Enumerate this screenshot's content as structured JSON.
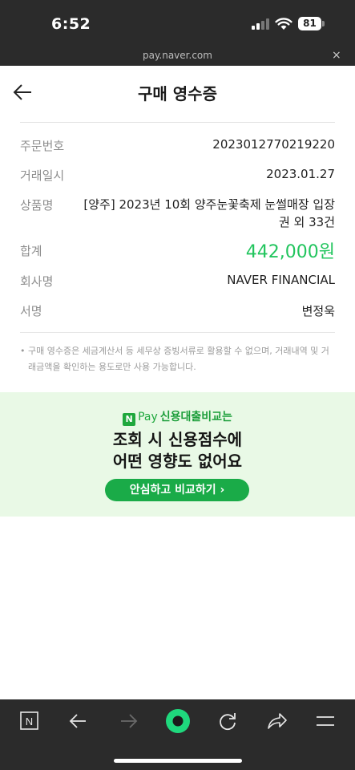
{
  "status_bar": {
    "time": "6:52",
    "battery": "81"
  },
  "url_bar": {
    "url": "pay.naver.com",
    "close": "×"
  },
  "header": {
    "title": "구매 영수증"
  },
  "receipt": {
    "rows": [
      {
        "label": "주문번호",
        "value": "2023012770219220"
      },
      {
        "label": "거래일시",
        "value": "2023.01.27"
      },
      {
        "label": "상품명",
        "value": "[양주] 2023년 10회 양주눈꽃축제 눈썰매장 입장권 외 33건"
      },
      {
        "label": "합계",
        "value": "442,000원"
      },
      {
        "label": "회사명",
        "value": "NAVER FINANCIAL"
      },
      {
        "label": "서명",
        "value": "변정욱"
      }
    ],
    "notice": "구매 영수증은 세금계산서 등 세무상 증빙서류로 활용할 수 없으며, 거래내역 및 거래금액을 확인하는 용도로만 사용 가능합니다.",
    "notice_bullet": "•"
  },
  "banner": {
    "brand_n": "N",
    "brand_pay": "Pay",
    "brand_text": "신용대출비교는",
    "headline_1": "조회 시 신용점수에",
    "headline_2": "어떤 영향도 없어요",
    "cta": "안심하고 비교하기 ›"
  },
  "toolbar": {
    "icons": [
      "naver-home-icon",
      "back-arrow-icon",
      "forward-arrow-icon",
      "green-dot-icon",
      "refresh-icon",
      "share-icon",
      "menu-icon"
    ],
    "n_label": "N"
  },
  "colors": {
    "accent_green": "#22c55e",
    "banner_bg": "#e9f9e6",
    "cta_bg": "#1aab48",
    "dark_bar": "#2b2b2b"
  }
}
